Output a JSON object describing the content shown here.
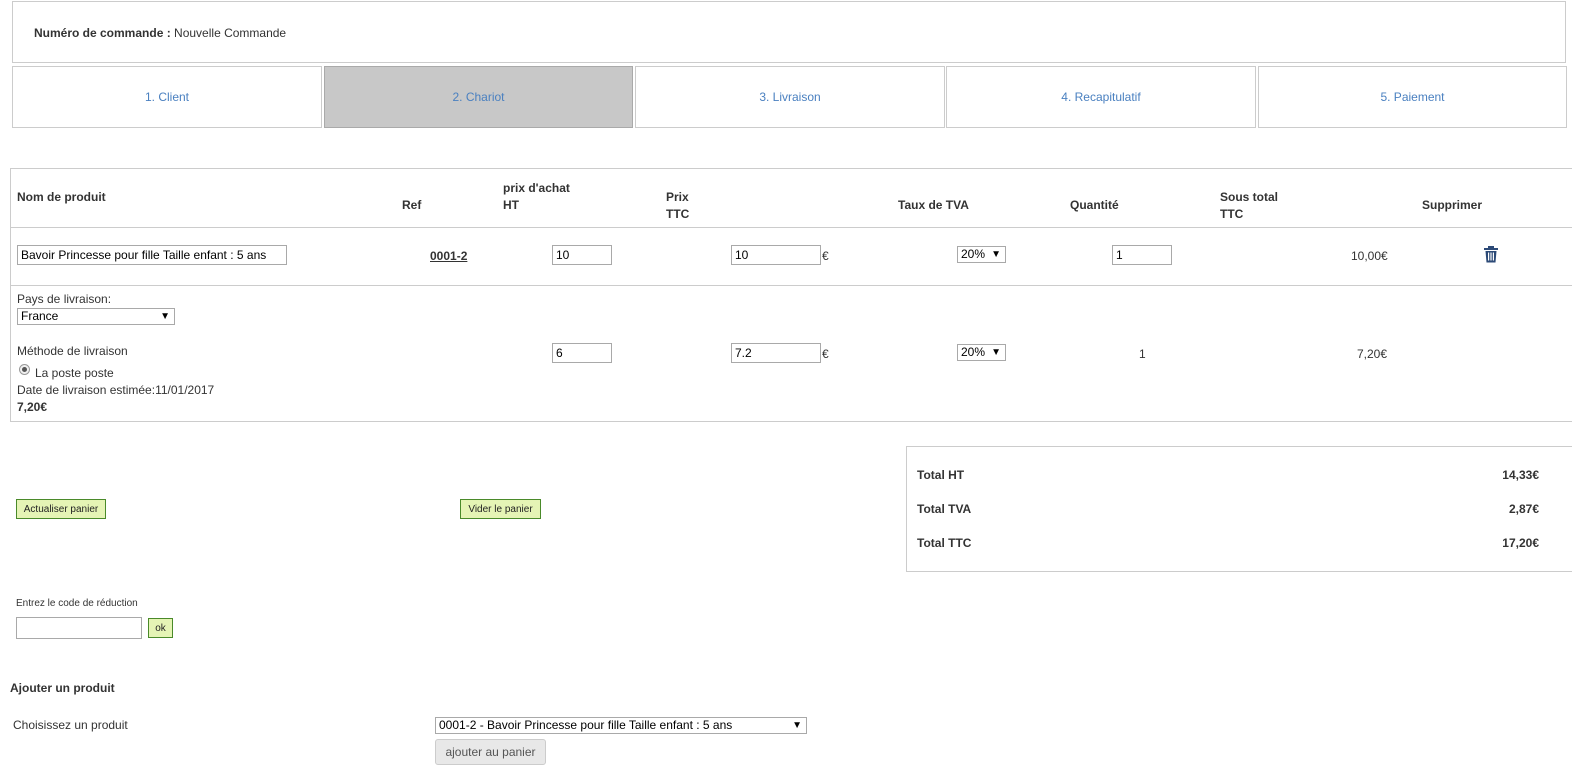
{
  "order": {
    "label": "Numéro de commande :",
    "value": "Nouvelle Commande"
  },
  "steps": [
    "1. Client",
    "2. Chariot",
    "3. Livraison",
    "4. Recapitulatif",
    "5. Paiement"
  ],
  "active_step": "2. Chariot",
  "table": {
    "headers": {
      "name": "Nom de produit",
      "ref": "Ref",
      "purchase_price": [
        "prix d'achat",
        "HT"
      ],
      "price": [
        "Prix",
        "TTC"
      ],
      "vat": "Taux de TVA",
      "qty": "Quantité",
      "subtotal": [
        "Sous total",
        "TTC"
      ],
      "delete": "Supprimer"
    },
    "product_row": {
      "name": "Bavoir Princesse pour fille Taille enfant : 5 ans",
      "ref": "0001-2",
      "purchase_price": "10",
      "price": "10",
      "currency": "€",
      "vat": "20%",
      "qty": "1",
      "subtotal": "10,00€",
      "delete_icon": "trash-icon"
    },
    "shipping": {
      "country_label": "Pays de livraison:",
      "country": "France",
      "method_label": "Méthode de livraison",
      "method_option": "La poste  poste",
      "estimated": "Date de livraison estimée:11/01/2017",
      "cost": "7,20€",
      "purchase_price": "6",
      "price": "7.2",
      "currency": "€",
      "vat": "20%",
      "qty": "1",
      "subtotal": "7,20€"
    }
  },
  "buttons": {
    "refresh": "Actualiser panier",
    "empty": "Vider le panier",
    "ok": "ok",
    "add": "ajouter au panier"
  },
  "totals": [
    {
      "label": "Total HT",
      "value": "14,33€"
    },
    {
      "label": "Total TVA",
      "value": "2,87€"
    },
    {
      "label": "Total TTC",
      "value": "17,20€"
    }
  ],
  "discount": {
    "label": "Entrez le code de réduction",
    "value": ""
  },
  "add_product": {
    "title": "Ajouter un produit",
    "choose_label": "Choisissez un produit",
    "selected": "0001-2 - Bavoir Princesse pour fille Taille enfant : 5 ans"
  }
}
